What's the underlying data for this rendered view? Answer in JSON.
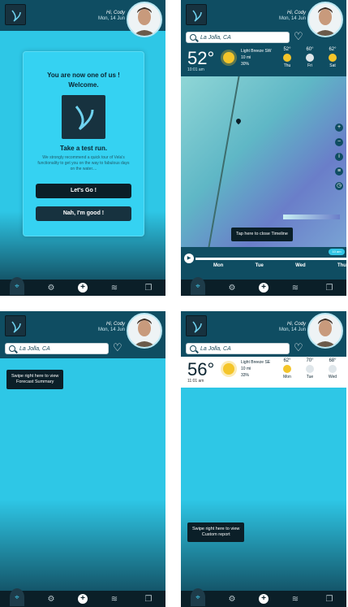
{
  "user": {
    "greeting": "Hi, Cody",
    "date": "Mon, 14 Jun"
  },
  "search": {
    "location": "La Jolla, CA"
  },
  "onboarding": {
    "title1": "You are now one of us !",
    "title2": "Welcome.",
    "title3": "Take a test run.",
    "body": "We strongly recommend a quick tour of Vela's functionality to get you on the way to fabulous days on the water....",
    "primary": "Let's Go !",
    "secondary": "Nah, I'm good !"
  },
  "weather_map": {
    "temp": "52°",
    "time": "10:01 am",
    "wind": "Light Breeze SW",
    "vis": "10 mi",
    "rain": "30%",
    "days": [
      {
        "t": "52°",
        "d": "Thu"
      },
      {
        "t": "60°",
        "d": "Fri"
      },
      {
        "t": "62°",
        "d": "Sat"
      }
    ],
    "tooltip": "Tap here to close Timeline",
    "timeline_badge": "10 am",
    "timeline_days": [
      "Mon",
      "Tue",
      "Wed",
      "Thu"
    ]
  },
  "forecast_tip": {
    "line1": "Swipe right here to view",
    "line2": "Forecast Summary"
  },
  "weather_report": {
    "temp": "56°",
    "time": "11:01 am",
    "wind": "Light Breeze SE",
    "vis": "10 mi",
    "rain": "33%",
    "days": [
      {
        "t": "62°",
        "d": "Mon"
      },
      {
        "t": "70°",
        "d": "Tue"
      },
      {
        "t": "68°",
        "d": "Wed"
      }
    ]
  },
  "custom_tip": {
    "line1": "Swipe right here to view",
    "line2": "Custom report"
  }
}
